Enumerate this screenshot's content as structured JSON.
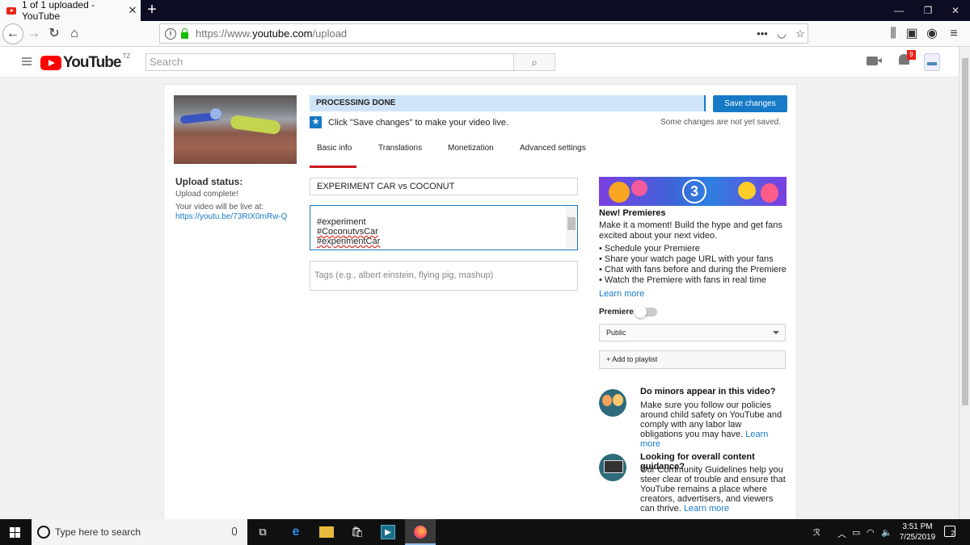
{
  "browser": {
    "tab_title": "1 of 1 uploaded - YouTube",
    "tab_close": "✕",
    "new_tab": "+",
    "window_controls": [
      "—",
      "❐",
      "✕"
    ],
    "url_prefix": "https://www.",
    "url_domain": "youtube.com",
    "url_path": "/upload",
    "url_menu": "•••"
  },
  "yt": {
    "logo_text": "YouTube",
    "country_code": "TZ",
    "search_placeholder": "Search",
    "notifications_count": "9"
  },
  "upload": {
    "status_label": "Upload status:",
    "status_value": "Upload complete!",
    "live_label": "Your video will be live at:",
    "video_link": "https://youtu.be/73RIX0mRw-Q",
    "processing": "PROCESSING DONE",
    "save_button": "Save changes",
    "hint": "Click \"Save changes\" to make your video live.",
    "not_saved": "Some changes are not yet saved.",
    "tabs": [
      "Basic info",
      "Translations",
      "Monetization",
      "Advanced settings"
    ],
    "title_value": "EXPERIMENT CAR vs COCONUT",
    "description_lines": [
      "#experiment",
      "#CoconutvsCar",
      "#experimentCar"
    ],
    "tags_placeholder": "Tags (e.g., albert einstein, flying pig, mashup)"
  },
  "premieres": {
    "banner_number": "3",
    "heading": "New! Premieres",
    "text": "Make it a moment! Build the hype and get fans excited about your next video.",
    "bullets": [
      "• Schedule your Premiere",
      "• Share your watch page URL with your fans",
      "• Chat with fans before and during the Premiere",
      "• Watch the Premiere with fans in real time"
    ],
    "learn_more": "Learn more",
    "toggle_label": "Premiere",
    "privacy_value": "Public",
    "playlist_button": "+ Add to playlist"
  },
  "guidance": {
    "minors_heading": "Do minors appear in this video?",
    "minors_text": "Make sure you follow our policies around child safety on YouTube and comply with any labor law obligations you may have.",
    "minors_link": "Learn more",
    "content_heading": "Looking for overall content guidance?",
    "content_text": "Our Community Guidelines help you steer clear of trouble and ensure that YouTube remains a place where creators, advertisers, and viewers can thrive.",
    "content_link": "Learn more"
  },
  "taskbar": {
    "search_placeholder": "Type here to search",
    "time": "3:51 PM",
    "date": "7/25/2019",
    "notifications": "2"
  }
}
